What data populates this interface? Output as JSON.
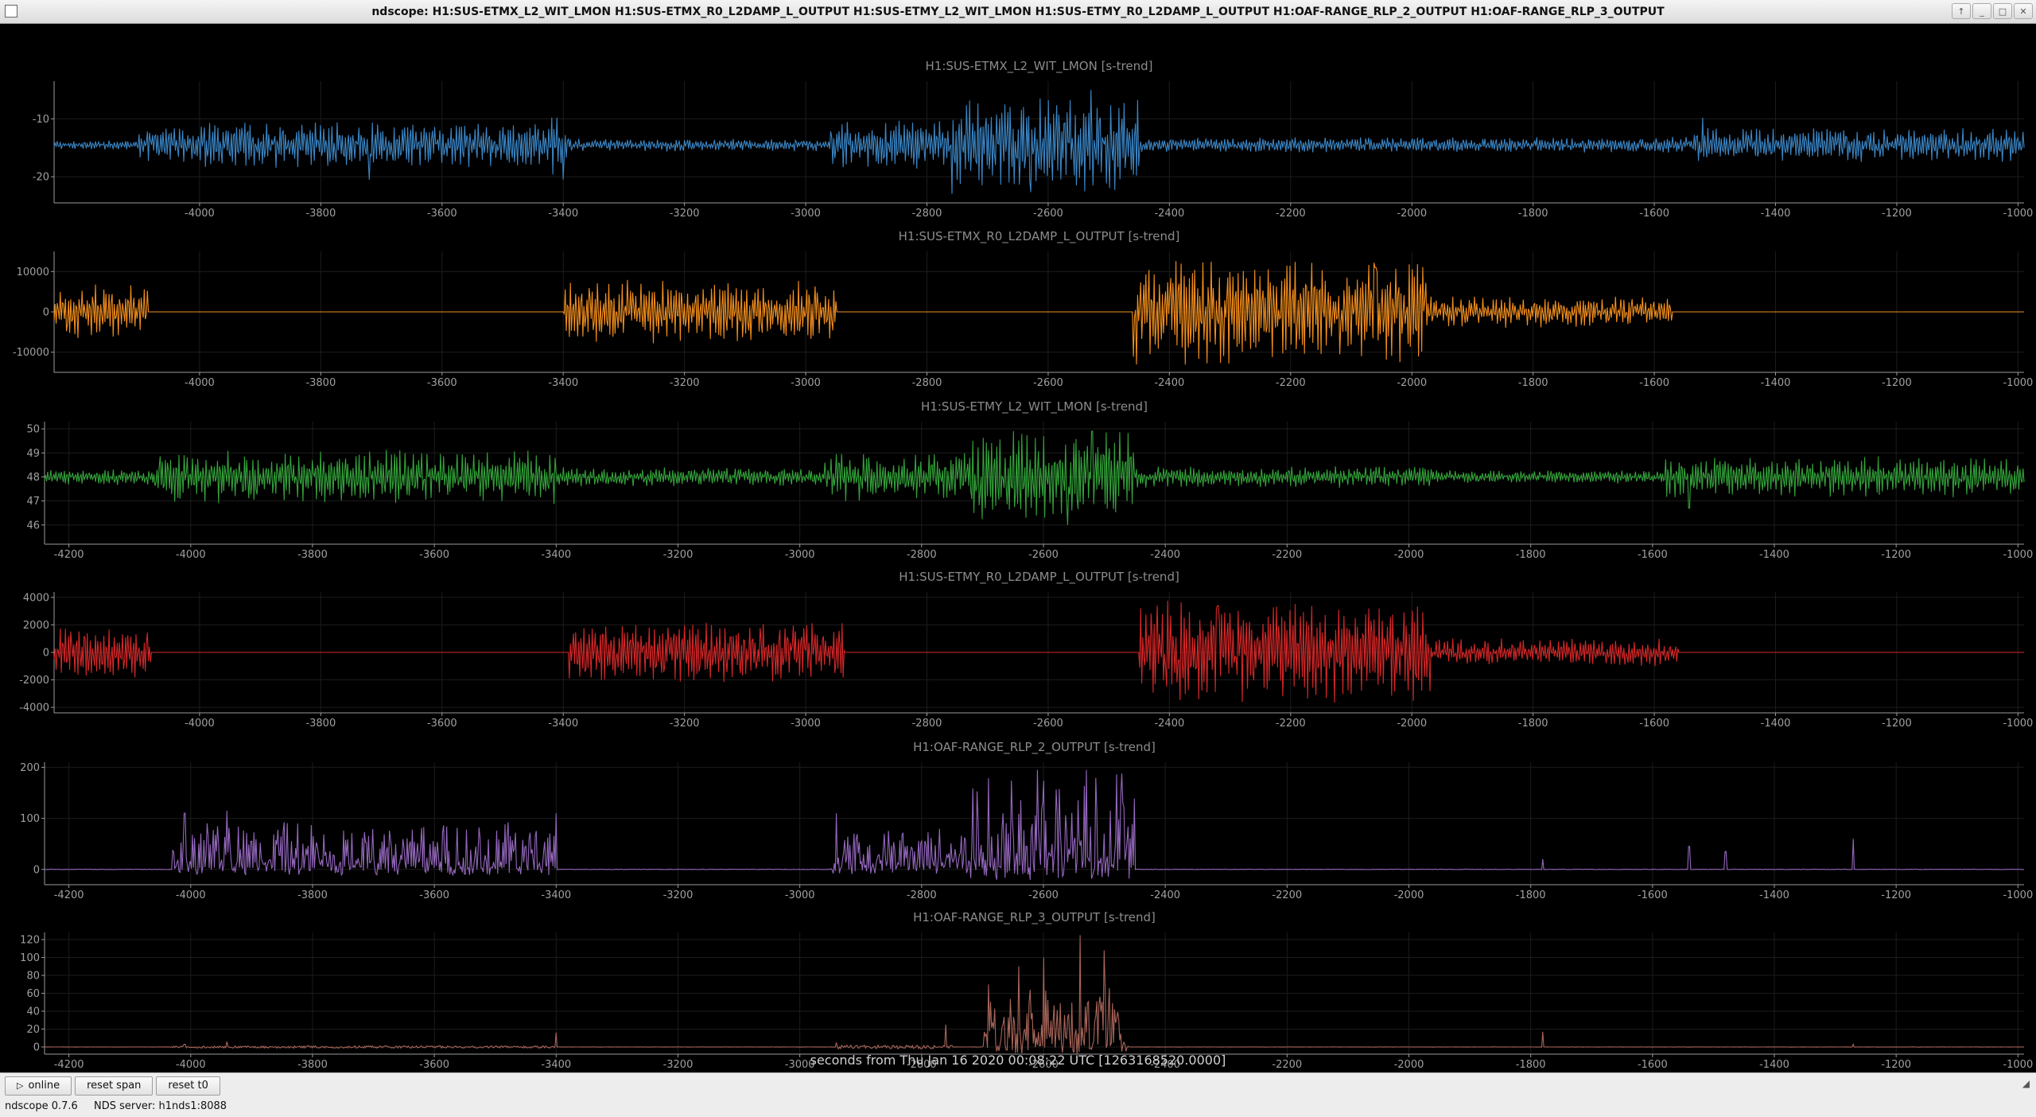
{
  "window": {
    "title": "ndscope: H1:SUS-ETMX_L2_WIT_LMON H1:SUS-ETMX_R0_L2DAMP_L_OUTPUT H1:SUS-ETMY_L2_WIT_LMON H1:SUS-ETMY_R0_L2DAMP_L_OUTPUT H1:OAF-RANGE_RLP_2_OUTPUT H1:OAF-RANGE_RLP_3_OUTPUT",
    "buttons": [
      "↑",
      "_",
      "□",
      "✕"
    ]
  },
  "xlabel": "seconds from Thu Jan 16 2020 00:08:22 UTC [1263168520.0000]",
  "toolbar": {
    "online": "online",
    "reset_span": "reset span",
    "reset_t0": "reset t0",
    "play_icon": "▷"
  },
  "status": {
    "version": "ndscope 0.7.6",
    "server": "NDS server: h1nds1:8088"
  },
  "chart_data": [
    {
      "type": "line",
      "title": "H1:SUS-ETMX_L2_WIT_LMON [s-trend]",
      "color": "#3b86c6",
      "xlim": [
        -4240,
        -990
      ],
      "xticks": [
        -4000,
        -3800,
        -3600,
        -3400,
        -3200,
        -3000,
        -2800,
        -2600,
        -2400,
        -2200,
        -2000,
        -1800,
        -1600,
        -1400,
        -1200,
        -1000
      ],
      "xtick_labels": [
        "-4000",
        "-3800",
        "-3600",
        "-3400",
        "-3200",
        "-3000",
        "-2800",
        "-2600",
        "-2400",
        "-2200",
        "-2000",
        "-1800",
        "-1600",
        "-1400",
        "-1200",
        "-1000"
      ],
      "ylim": [
        -24.5,
        -3.5
      ],
      "yticks": [
        -10,
        -20
      ],
      "ytick_labels": [
        "-10",
        "-20"
      ],
      "series": [
        {
          "baseline": -14.5,
          "base_amp": 0.7,
          "segments": [
            [
              -4240,
              -4100,
              0.7
            ],
            [
              -4100,
              -4000,
              2.6
            ],
            [
              -4000,
              -3420,
              3.5
            ],
            [
              -3420,
              -3390,
              4.8
            ],
            [
              -3390,
              -2960,
              1.0
            ],
            [
              -2960,
              -2760,
              3.8
            ],
            [
              -2760,
              -2450,
              7.5
            ],
            [
              -2450,
              -1540,
              1.2
            ],
            [
              -1540,
              -990,
              2.6
            ]
          ],
          "peaks": [
            [
              -3720,
              -20.5
            ],
            [
              -3400,
              -20.5
            ],
            [
              -3410,
              -9.8
            ],
            [
              -2530,
              -5.0
            ],
            [
              -2600,
              -6.8
            ],
            [
              -2630,
              -20.8
            ],
            [
              -1520,
              -9.8
            ]
          ]
        }
      ]
    },
    {
      "type": "line",
      "title": "H1:SUS-ETMX_R0_L2DAMP_L_OUTPUT [s-trend]",
      "color": "#f28e1c",
      "xlim": [
        -4240,
        -990
      ],
      "xticks": [
        -4000,
        -3800,
        -3600,
        -3400,
        -3200,
        -3000,
        -2800,
        -2600,
        -2400,
        -2200,
        -2000,
        -1800,
        -1600,
        -1400,
        -1200,
        -1000
      ],
      "xtick_labels": [
        "-4000",
        "-3800",
        "-3600",
        "-3400",
        "-3200",
        "-3000",
        "-2800",
        "-2600",
        "-2400",
        "-2200",
        "-2000",
        "-1800",
        "-1600",
        "-1400",
        "-1200",
        "-1000"
      ],
      "ylim": [
        -15000,
        15000
      ],
      "yticks": [
        10000,
        0,
        -10000
      ],
      "ytick_labels": [
        "10000",
        "0",
        "-10000"
      ],
      "series": [
        {
          "baseline": 0,
          "base_amp": 0,
          "segments": [
            [
              -4240,
              -4085,
              6000
            ],
            [
              -3400,
              -2950,
              7000
            ],
            [
              -2460,
              -1975,
              11500
            ],
            [
              -1975,
              -1570,
              3500
            ]
          ],
          "peaks": [
            [
              -2380,
              12000
            ],
            [
              -2020,
              -12500
            ],
            [
              -2060,
              11000
            ]
          ]
        }
      ]
    },
    {
      "type": "line",
      "title": "H1:SUS-ETMY_L2_WIT_LMON [s-trend]",
      "color": "#33a33a",
      "xlim": [
        -4240,
        -990
      ],
      "xticks": [
        -4200,
        -4000,
        -3800,
        -3600,
        -3400,
        -3200,
        -3000,
        -2800,
        -2600,
        -2400,
        -2200,
        -2000,
        -1800,
        -1600,
        -1400,
        -1200,
        -1000
      ],
      "xtick_labels": [
        "-4200",
        "-4000",
        "-3800",
        "-3600",
        "-3400",
        "-3200",
        "-3000",
        "-2800",
        "-2600",
        "-2400",
        "-2200",
        "-2000",
        "-1800",
        "-1600",
        "-1400",
        "-1200",
        "-1000"
      ],
      "ylim": [
        45.2,
        50.3
      ],
      "yticks": [
        50,
        49,
        48,
        47,
        46
      ],
      "ytick_labels": [
        "50",
        "49",
        "48",
        "47",
        "46"
      ],
      "series": [
        {
          "baseline": 48,
          "base_amp": 0.25,
          "segments": [
            [
              -4240,
              -4060,
              0.3
            ],
            [
              -4060,
              -3400,
              1.0
            ],
            [
              -3400,
              -2960,
              0.35
            ],
            [
              -2960,
              -2720,
              0.9
            ],
            [
              -2720,
              -2450,
              1.7
            ],
            [
              -2450,
              -1960,
              0.4
            ],
            [
              -1960,
              -1580,
              0.25
            ],
            [
              -1580,
              -990,
              0.75
            ]
          ],
          "peaks": [
            [
              -2520,
              49.9
            ],
            [
              -2560,
              46.0
            ],
            [
              -2600,
              49.7
            ],
            [
              -1540,
              46.7
            ]
          ]
        }
      ]
    },
    {
      "type": "line",
      "title": "H1:SUS-ETMY_R0_L2DAMP_L_OUTPUT [s-trend]",
      "color": "#d62728",
      "xlim": [
        -4240,
        -990
      ],
      "xticks": [
        -4000,
        -3800,
        -3600,
        -3400,
        -3200,
        -3000,
        -2800,
        -2600,
        -2400,
        -2200,
        -2000,
        -1800,
        -1600,
        -1400,
        -1200,
        -1000
      ],
      "xtick_labels": [
        "-4000",
        "-3800",
        "-3600",
        "-3400",
        "-3200",
        "-3000",
        "-2800",
        "-2600",
        "-2400",
        "-2200",
        "-2000",
        "-1800",
        "-1600",
        "-1400",
        "-1200",
        "-1000"
      ],
      "ylim": [
        -4400,
        4400
      ],
      "yticks": [
        4000,
        2000,
        0,
        -2000,
        -4000
      ],
      "ytick_labels": [
        "4000",
        "2000",
        "0",
        "-2000",
        "-4000"
      ],
      "series": [
        {
          "baseline": 0,
          "base_amp": 0,
          "segments": [
            [
              -4240,
              -4080,
              1700
            ],
            [
              -3390,
              -2935,
              1900
            ],
            [
              -2450,
              -1970,
              3300
            ],
            [
              -1970,
              -1560,
              900
            ]
          ],
          "peaks": [
            [
              -2280,
              -3600
            ],
            [
              -2420,
              3400
            ],
            [
              -2320,
              3400
            ]
          ]
        }
      ]
    },
    {
      "type": "line",
      "title": "H1:OAF-RANGE_RLP_2_OUTPUT [s-trend]",
      "color": "#9467bd",
      "xlim": [
        -4240,
        -990
      ],
      "xticks": [
        -4200,
        -4000,
        -3800,
        -3600,
        -3400,
        -3200,
        -3000,
        -2800,
        -2600,
        -2400,
        -2200,
        -2000,
        -1800,
        -1600,
        -1400,
        -1200,
        -1000
      ],
      "xtick_labels": [
        "-4200",
        "-4000",
        "-3800",
        "-3600",
        "-3400",
        "-3200",
        "-3000",
        "-2800",
        "-2600",
        "-2400",
        "-2200",
        "-2000",
        "-1800",
        "-1600",
        "-1400",
        "-1200",
        "-1000"
      ],
      "ylim": [
        -30,
        210
      ],
      "yticks": [
        200,
        100,
        0
      ],
      "ytick_labels": [
        "200",
        "100",
        "0"
      ],
      "series": [
        {
          "baseline": 0,
          "base_amp": 1,
          "segments": [
            [
              -4030,
              -3400,
              95
            ],
            [
              -2950,
              -2720,
              80
            ],
            [
              -2720,
              -2450,
              190
            ]
          ],
          "peaks": [
            [
              -4010,
              110
            ],
            [
              -3940,
              115
            ],
            [
              -3400,
              110
            ],
            [
              -2940,
              110
            ],
            [
              -2610,
              195
            ],
            [
              -2530,
              195
            ],
            [
              -2470,
              130
            ],
            [
              -1780,
              20
            ],
            [
              -1540,
              45
            ],
            [
              -1480,
              35
            ],
            [
              -1270,
              60
            ]
          ]
        }
      ]
    },
    {
      "type": "line",
      "title": "H1:OAF-RANGE_RLP_3_OUTPUT [s-trend]",
      "color": "#a9655a",
      "xlim": [
        -4240,
        -990
      ],
      "xticks": [
        -4200,
        -4000,
        -3800,
        -3600,
        -3400,
        -3200,
        -3000,
        -2800,
        -2600,
        -2400,
        -2200,
        -2000,
        -1800,
        -1600,
        -1400,
        -1200,
        -1000
      ],
      "xtick_labels": [
        "-4200",
        "-4000",
        "-3800",
        "-3600",
        "-3400",
        "-3200",
        "-3000",
        "-2800",
        "-2600",
        "-2400",
        "-2200",
        "-2000",
        "-1800",
        "-1600",
        "-1400",
        "-1200",
        "-1000"
      ],
      "ylim": [
        -8,
        128
      ],
      "yticks": [
        120,
        100,
        80,
        60,
        40,
        20,
        0
      ],
      "ytick_labels": [
        "120",
        "100",
        "80",
        "60",
        "40",
        "20",
        "0"
      ],
      "series": [
        {
          "baseline": 0,
          "base_amp": 0.3,
          "segments": [
            [
              -4030,
              -3400,
              2.5
            ],
            [
              -2940,
              -2750,
              4
            ],
            [
              -2700,
              -2460,
              70
            ]
          ],
          "peaks": [
            [
              -4010,
              3
            ],
            [
              -3940,
              6
            ],
            [
              -3400,
              16
            ],
            [
              -2940,
              5
            ],
            [
              -2760,
              25
            ],
            [
              -2540,
              125
            ],
            [
              -2600,
              100
            ],
            [
              -2500,
              108
            ],
            [
              -2640,
              90
            ],
            [
              -1780,
              17
            ],
            [
              -1270,
              3
            ]
          ]
        }
      ]
    }
  ]
}
